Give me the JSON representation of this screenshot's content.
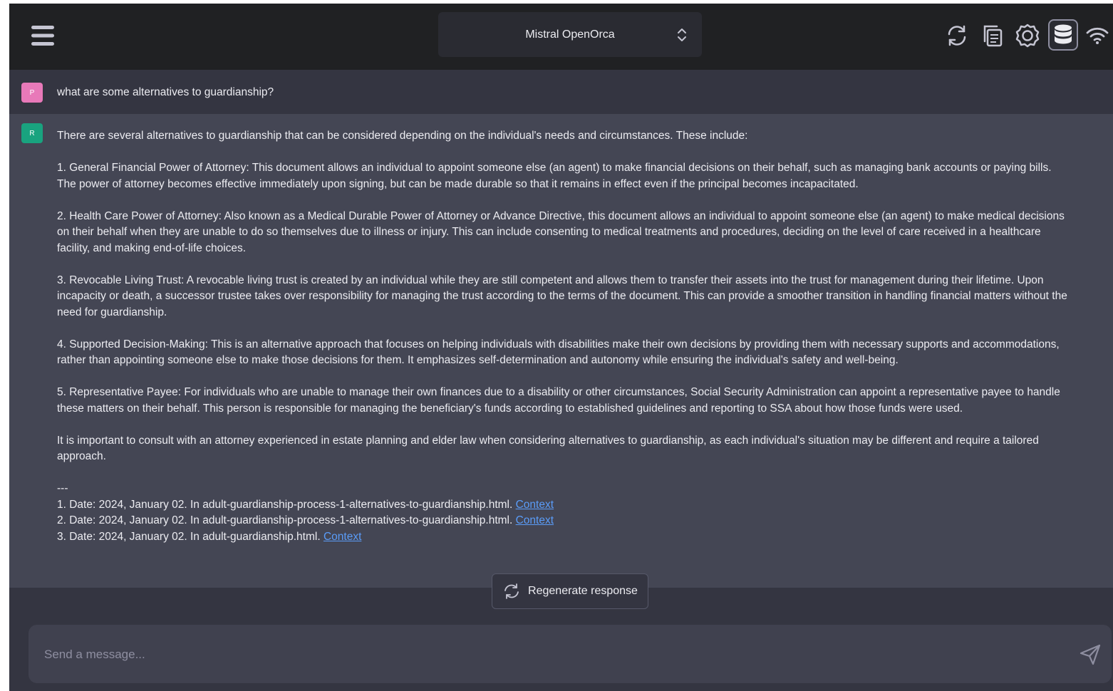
{
  "header": {
    "model_name": "Mistral OpenOrca",
    "icons": [
      "menu-icon",
      "refresh-icon",
      "copy-icon",
      "settings-icon",
      "database-icon",
      "wifi-icon"
    ]
  },
  "conversation": {
    "user": {
      "avatar_letter": "P",
      "text": "what are some alternatives to guardianship?"
    },
    "bot": {
      "avatar_letter": "R",
      "paragraphs": [
        "There are several alternatives to guardianship that can be considered depending on the individual's needs and circumstances. These include:",
        "1. General Financial Power of Attorney: This document allows an individual to appoint someone else (an agent) to make financial decisions on their behalf, such as managing bank accounts or paying bills. The power of attorney becomes effective immediately upon signing, but can be made durable so that it remains in effect even if the principal becomes incapacitated.",
        "2. Health Care Power of Attorney: Also known as a Medical Durable Power of Attorney or Advance Directive, this document allows an individual to appoint someone else (an agent) to make medical decisions on their behalf when they are unable to do so themselves due to illness or injury. This can include consenting to medical treatments and procedures, deciding on the level of care received in a healthcare facility, and making end-of-life choices.",
        "3. Revocable Living Trust: A revocable living trust is created by an individual while they are still competent and allows them to transfer their assets into the trust for management during their lifetime. Upon incapacity or death, a successor trustee takes over responsibility for managing the trust according to the terms of the document. This can provide a smoother transition in handling financial matters without the need for guardianship.",
        "4. Supported Decision-Making: This is an alternative approach that focuses on helping individuals with disabilities make their own decisions by providing them with necessary supports and accommodations, rather than appointing someone else to make those decisions for them. It emphasizes self-determination and autonomy while ensuring the individual's safety and well-being.",
        "5. Representative Payee: For individuals who are unable to manage their own finances due to a disability or other circumstances, Social Security Administration can appoint a representative payee to handle these matters on their behalf. This person is responsible for managing the beneficiary's funds according to established guidelines and reporting to SSA about how those funds were used.",
        "It is important to consult with an attorney experienced in estate planning and elder law when considering alternatives to guardianship, as each individual's situation may be different and require a tailored approach."
      ],
      "separator": "---",
      "sources": [
        {
          "text": "1. Date: 2024, January 02. In adult-guardianship-process-1-alternatives-to-guardianship.html. ",
          "link": "Context"
        },
        {
          "text": "2. Date: 2024, January 02. In adult-guardianship-process-1-alternatives-to-guardianship.html. ",
          "link": "Context"
        },
        {
          "text": "3. Date: 2024, January 02. In adult-guardianship.html. ",
          "link": "Context"
        }
      ]
    }
  },
  "regenerate_label": "Regenerate response",
  "composer": {
    "placeholder": "Send a message...",
    "value": ""
  }
}
